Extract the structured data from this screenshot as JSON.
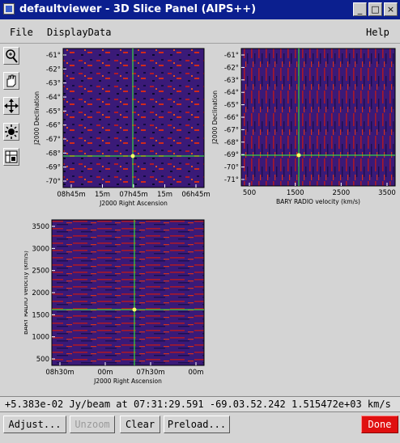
{
  "window": {
    "title": "defaultviewer - 3D Slice Panel (AIPS++)"
  },
  "menu": {
    "file": "File",
    "display_data": "DisplayData",
    "help": "Help"
  },
  "tools": [
    "zoom-icon",
    "pan-hand-icon",
    "move-crosshair-icon",
    "colormap-icon",
    "profile-icon"
  ],
  "panels": {
    "ra_dec": {
      "y_axis_label": "J2000 Declination",
      "x_axis_label": "J2000 Right Ascension",
      "y_ticks": [
        "-61°",
        "-62°",
        "-63°",
        "-64°",
        "-65°",
        "-66°",
        "-67°",
        "-68°",
        "-69°",
        "-70°"
      ],
      "x_ticks": [
        "08h45m",
        "15m",
        "07h45m",
        "15m",
        "06h45m"
      ]
    },
    "vel_dec": {
      "y_axis_label": "J2000 Declination",
      "x_axis_label": "BARY RADIO velocity (km/s)",
      "y_ticks": [
        "-61°",
        "-62°",
        "-63°",
        "-64°",
        "-65°",
        "-66°",
        "-67°",
        "-68°",
        "-69°",
        "-70°",
        "-71°"
      ],
      "x_ticks": [
        "500",
        "1500",
        "2500",
        "3500"
      ]
    },
    "ra_vel": {
      "y_axis_label": "BARY RADIO velocity (km/s)",
      "x_axis_label": "J2000 Right Ascension",
      "y_ticks": [
        "3500",
        "3000",
        "2500",
        "2000",
        "1500",
        "1000",
        "500"
      ],
      "x_ticks": [
        "08h30m",
        "00m",
        "07h30m",
        "00m"
      ]
    }
  },
  "status": {
    "readout": "+5.383e-02 Jy/beam at 07:31:29.591 -69.03.52.242 1.515472e+03 km/s"
  },
  "buttons": {
    "adjust": "Adjust...",
    "unzoom": "Unzoom",
    "clear": "Clear",
    "preload": "Preload...",
    "done": "Done"
  },
  "colors": {
    "titlebar": "#0b1f8f",
    "done": "#e01010",
    "crosshair": "#33ff33",
    "image_bg": "#3a1a78"
  }
}
